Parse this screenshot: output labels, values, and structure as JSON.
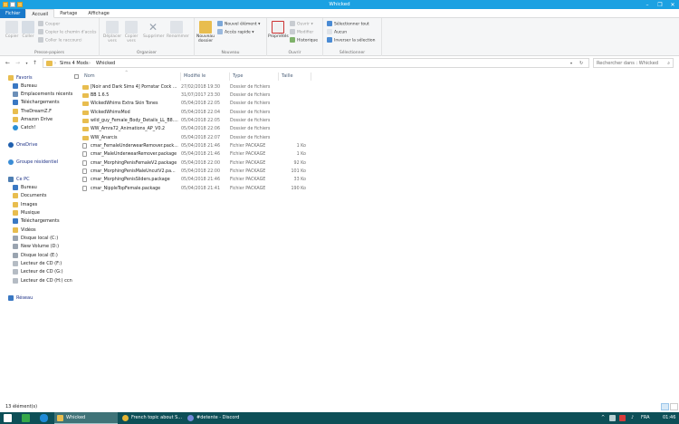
{
  "window": {
    "title": "Whicked"
  },
  "tabs": [
    "Fichier",
    "Accueil",
    "Partage",
    "Affichage"
  ],
  "ribbon": {
    "clipboard": {
      "pin": "Épingler dans Accès rapide",
      "copy": "Copier",
      "paste": "Coller",
      "cut": "Couper",
      "copy_path": "Copier le chemin d'accès",
      "paste_shortcut": "Coller le raccourci",
      "group": "Presse-papiers"
    },
    "organize": {
      "move": "Déplacer vers",
      "copy_to": "Copier vers",
      "delete": "Supprimer",
      "rename": "Renommer",
      "group": "Organiser"
    },
    "new": {
      "new_folder": "Nouveau dossier",
      "new_item": "Nouvel élément",
      "easy_access": "Accès rapide",
      "group": "Nouveau"
    },
    "open": {
      "properties": "Propriétés",
      "open": "Ouvrir",
      "edit": "Modifier",
      "history": "Historique",
      "group": "Ouvrir"
    },
    "select": {
      "select_all": "Sélectionner tout",
      "select_none": "Aucun",
      "invert": "Inverser la sélection",
      "group": "Sélectionner"
    }
  },
  "address": {
    "crumbs": [
      "Sims 4 Mods",
      "Whicked"
    ]
  },
  "search": {
    "placeholder": "Rechercher dans : Whicked"
  },
  "nav": [
    {
      "label": "Favoris",
      "icon": "star-icon",
      "header": true
    },
    {
      "label": "Bureau",
      "icon": "desktop-icon"
    },
    {
      "label": "Emplacements récents",
      "icon": "recent-icon"
    },
    {
      "label": "Téléchargements",
      "icon": "download-icon"
    },
    {
      "label": "TheDreamZ.F",
      "icon": "folder-icon"
    },
    {
      "label": "Amazon Drive",
      "icon": "folder-icon"
    },
    {
      "label": "Catch!",
      "icon": "catch-icon"
    },
    {
      "label": "OneDrive",
      "icon": "cloud-icon",
      "header": true
    },
    {
      "label": "Groupe résidentiel",
      "icon": "homegroup-icon",
      "header": true
    },
    {
      "label": "Ce PC",
      "icon": "computer-icon",
      "header": true
    },
    {
      "label": "Bureau",
      "icon": "desktop-icon"
    },
    {
      "label": "Documents",
      "icon": "folder-icon"
    },
    {
      "label": "Images",
      "icon": "folder-icon"
    },
    {
      "label": "Musique",
      "icon": "folder-icon"
    },
    {
      "label": "Téléchargements",
      "icon": "download-icon"
    },
    {
      "label": "Vidéos",
      "icon": "folder-icon"
    },
    {
      "label": "Disque local (C:)",
      "icon": "drive-icon"
    },
    {
      "label": "New Volume (D:)",
      "icon": "drive-icon"
    },
    {
      "label": "Disque local (E:)",
      "icon": "drive-icon"
    },
    {
      "label": "Lecteur de CD (F:)",
      "icon": "cd-icon"
    },
    {
      "label": "Lecteur de CD (G:)",
      "icon": "cd-icon"
    },
    {
      "label": "Lecteur de CD (H:) ccn",
      "icon": "cd-icon"
    },
    {
      "label": "Réseau",
      "icon": "network-icon",
      "header": true
    }
  ],
  "columns": [
    "Nom",
    "Modifié le",
    "Type",
    "Taille"
  ],
  "files": [
    {
      "name": "[Noir and Dark Sims 4] Pornstar Cock ...",
      "date": "27/02/2018 19:30",
      "type": "Dossier de fichiers",
      "size": "",
      "kind": "folder"
    },
    {
      "name": "BB 1.6.5",
      "date": "31/07/2017 23:30",
      "type": "Dossier de fichiers",
      "size": "",
      "kind": "folder"
    },
    {
      "name": "WickedWhims Extra Skin Tones",
      "date": "05/04/2018 22:05",
      "type": "Dossier de fichiers",
      "size": "",
      "kind": "folder"
    },
    {
      "name": "WickedWhimsMod",
      "date": "05/04/2018 22:04",
      "type": "Dossier de fichiers",
      "size": "",
      "kind": "folder"
    },
    {
      "name": "wild_guy_Female_Body_Details_LL_B8....",
      "date": "05/04/2018 22:05",
      "type": "Dossier de fichiers",
      "size": "",
      "kind": "folder"
    },
    {
      "name": "WW_Amra72_Animations_AP_V0.2",
      "date": "05/04/2018 22:06",
      "type": "Dossier de fichiers",
      "size": "",
      "kind": "folder"
    },
    {
      "name": "WW_Anarcis",
      "date": "05/04/2018 22:07",
      "type": "Dossier de fichiers",
      "size": "",
      "kind": "folder"
    },
    {
      "name": "cmar_FemaleUnderwearRemover.pack...",
      "date": "05/04/2018 21:46",
      "type": "Fichier PACKAGE",
      "size": "1 Ko",
      "kind": "file"
    },
    {
      "name": "cmar_MaleUnderwearRemover.package",
      "date": "05/04/2018 21:46",
      "type": "Fichier PACKAGE",
      "size": "1 Ko",
      "kind": "file"
    },
    {
      "name": "cmar_MorphingPenisFemaleV2.package",
      "date": "05/04/2018 22:00",
      "type": "Fichier PACKAGE",
      "size": "92 Ko",
      "kind": "file"
    },
    {
      "name": "cmar_MorphingPenisMaleUncutV2.pa...",
      "date": "05/04/2018 22:00",
      "type": "Fichier PACKAGE",
      "size": "101 Ko",
      "kind": "file"
    },
    {
      "name": "cmar_MorphingPenisSliders.package",
      "date": "05/04/2018 21:46",
      "type": "Fichier PACKAGE",
      "size": "33 Ko",
      "kind": "file"
    },
    {
      "name": "cmar_NippleTopFemale.package",
      "date": "05/04/2018 21:41",
      "type": "Fichier PACKAGE",
      "size": "190 Ko",
      "kind": "file"
    }
  ],
  "status": {
    "count": "13 élément(s)"
  },
  "taskbar": {
    "tasks": [
      "Whicked",
      "French topic about S...",
      "#detente - Discord"
    ],
    "lang": "FRA",
    "time": "01:46"
  },
  "colors": {
    "titlebar": "#1ba1e2",
    "taskbar": "#0d4f57",
    "folder": "#e8bd4f",
    "file_tab": "#1979ca"
  }
}
